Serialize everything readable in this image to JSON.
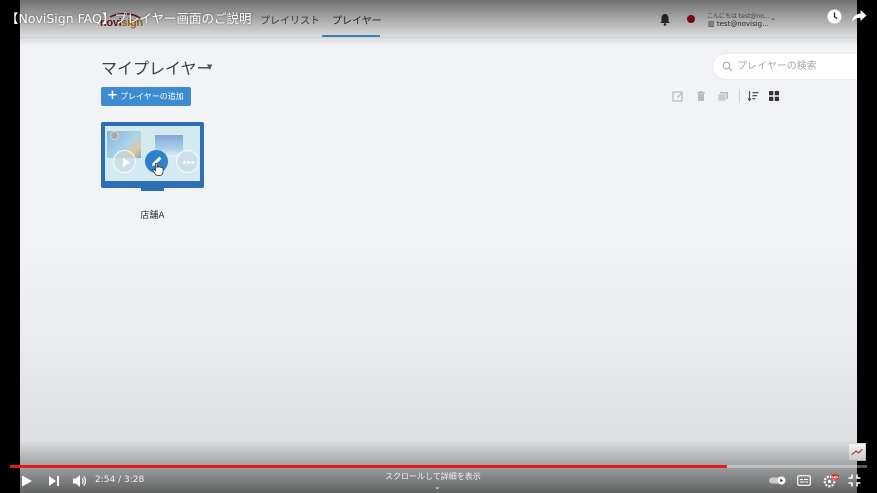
{
  "video": {
    "title": "【NoviSign FAQ】プレイヤー画面のご説明",
    "time_current": "2:54",
    "time_total": "3:28",
    "time_display": "2:54 / 3:28",
    "progress": 0.837,
    "scroll_hint": "スクロールして詳細を表示",
    "scroll_chevron": "⌄"
  },
  "app": {
    "logo": {
      "main": "novi",
      "sub": "sign"
    },
    "nav": {
      "playlist": "プレイリスト",
      "player": "プレイヤー"
    },
    "user": {
      "greeting": "こんにちは test@no...",
      "email": "test@novisig..."
    },
    "page_title": "マイプレイヤー",
    "search": {
      "placeholder": "プレイヤーの検索"
    },
    "add_button": "プレイヤーの追加",
    "players": [
      {
        "name": "店舗A"
      }
    ]
  },
  "colors": {
    "accent": "#3d8bd0",
    "player_frame": "#2d6fb7",
    "progress": "#e21b1b",
    "logo": "#8a1b22"
  },
  "icons": [
    "bell-icon",
    "search-icon",
    "edit-icon",
    "trash-icon",
    "copy-icon",
    "sort-icon",
    "grid-icon",
    "play-icon",
    "pencil-icon",
    "more-icon",
    "hand-cursor-icon",
    "clock-icon",
    "share-icon",
    "next-icon",
    "volume-icon",
    "subtitles-icon",
    "settings-icon",
    "exit-fullscreen-icon"
  ]
}
